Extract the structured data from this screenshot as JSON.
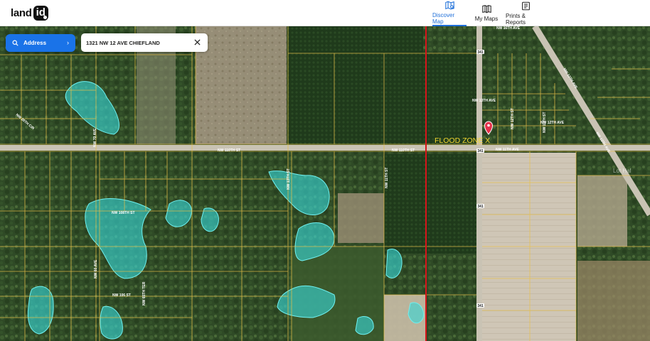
{
  "brand": {
    "word": "land",
    "badge": "id"
  },
  "nav": [
    {
      "label": "Discover Map",
      "icon": "map-search-icon",
      "active": true
    },
    {
      "label": "My Maps",
      "icon": "book-icon",
      "active": false
    },
    {
      "label": "Prints & Reports",
      "icon": "report-icon",
      "active": false
    }
  ],
  "search": {
    "mode_label": "Address",
    "value": "1321 NW 12 AVE CHIEFLAND"
  },
  "map": {
    "overlay_label": "FLOOD ZONE X",
    "watermark": "Lot Hal",
    "streets": [
      "NW 110TH ST",
      "NW 110TH ST",
      "NW 11TH AVE",
      "NW 13TH AVE",
      "NW 12TH AVE",
      "NW 108TH ST",
      "NW 106 ST",
      "NW 16TH AVE",
      "NW 14TH AVE",
      "NW 13TH AVE",
      "NW 70 AVE",
      "NW 60 AVE",
      "NW 65TH TER",
      "NW 20TH CIR",
      "NW 13TH ST",
      "NW 11TH ST",
      "NW 12TH ST",
      "NW 11TH ST",
      "NW 12TH AVE",
      "NW 13TH AVE"
    ],
    "route_shield": "341",
    "colors": {
      "parcel_line": "#e8c14a",
      "flood_fill": "#38d6d6",
      "boundary_line": "#d8151b",
      "accent": "#1a73e8"
    }
  }
}
